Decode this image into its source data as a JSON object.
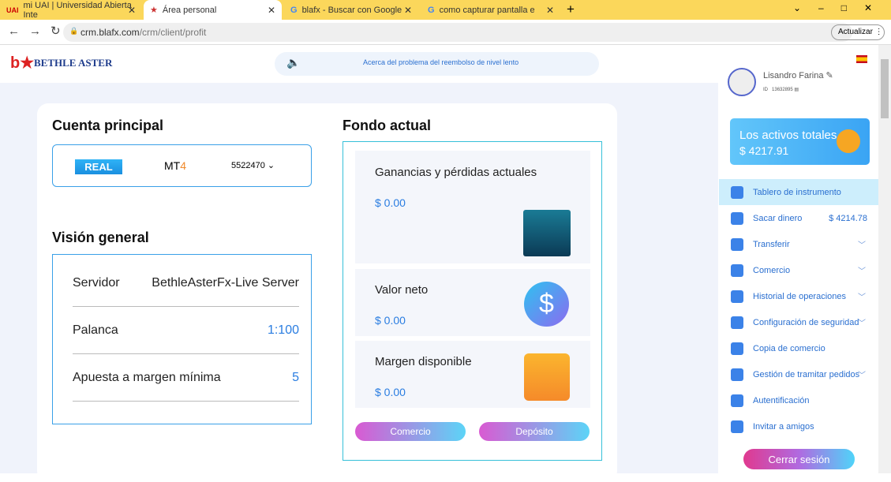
{
  "browser": {
    "tabs": [
      "mi UAI | Universidad Abierta Inte",
      "Área personal",
      "blafx - Buscar con Google",
      "como capturar pantalla en la pc"
    ],
    "url_host": "crm.blafx.com",
    "url_path": "/crm/client/profit",
    "update_label": "Actualizar"
  },
  "header": {
    "logo": "BETHLE ASTER",
    "notice": "Acerca del problema del reembolso de nivel lento"
  },
  "account": {
    "title": "Cuenta principal",
    "type_badge": "REAL",
    "platform_prefix": "MT",
    "platform_num": "4",
    "account_number": "5522470"
  },
  "overview": {
    "title": "Visión general",
    "rows": [
      {
        "label": "Servidor",
        "value": "BethleAsterFx-Live Server"
      },
      {
        "label": "Palanca",
        "value": "1:100"
      },
      {
        "label": "Apuesta a margen mínima",
        "value": "5"
      }
    ]
  },
  "fund": {
    "title": "Fondo actual",
    "panels": [
      {
        "label": "Ganancias y pérdidas actuales",
        "value": "$ 0.00"
      },
      {
        "label": "Valor neto",
        "value": "$ 0.00"
      },
      {
        "label": "Margen disponible",
        "value": "$ 0.00"
      }
    ],
    "trade_button": "Comercio",
    "deposit_button": "Depósito"
  },
  "user": {
    "name": "Lisandro Farina",
    "id_label": "ID",
    "id": "13632895"
  },
  "assets": {
    "label": "Los activos totales",
    "value": "$ 4217.91"
  },
  "nav": [
    {
      "label": "Tablero de instrumento"
    },
    {
      "label": "Sacar dinero",
      "extra": "$ 4214.78"
    },
    {
      "label": "Transferir",
      "chev": true
    },
    {
      "label": "Comercio",
      "chev": true
    },
    {
      "label": "Historial de operaciones",
      "chev": true
    },
    {
      "label": "Configuración de seguridad",
      "chev": true
    },
    {
      "label": "Copia de comercio"
    },
    {
      "label": "Gestión de tramitar pedidos",
      "chev": true
    },
    {
      "label": "Autentificación"
    },
    {
      "label": "Invitar a amigos"
    }
  ],
  "logout": "Cerrar sesión"
}
